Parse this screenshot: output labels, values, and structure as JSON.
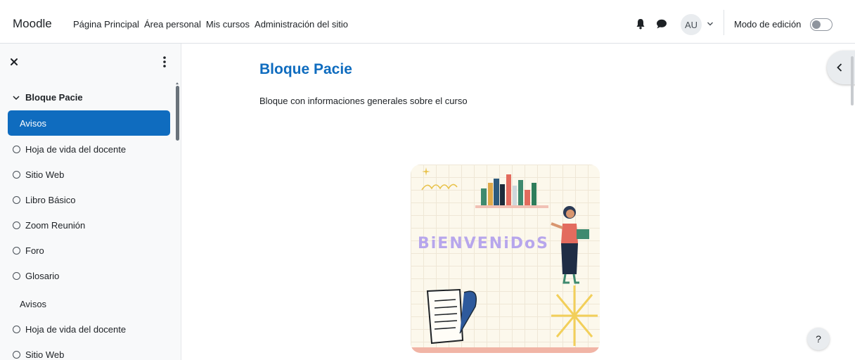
{
  "navbar": {
    "brand": "Moodle",
    "links": [
      "Página Principal",
      "Área personal",
      "Mis cursos",
      "Administración del sitio"
    ],
    "avatar_initials": "AU",
    "edit_mode_label": "Modo de edición",
    "edit_mode_on": false
  },
  "drawer": {
    "section_title": "Bloque Pacie",
    "items": [
      {
        "label": "Avisos",
        "active": true,
        "marker": false
      },
      {
        "label": "Hoja de vida del docente",
        "active": false,
        "marker": true
      },
      {
        "label": "Sitio Web",
        "active": false,
        "marker": true
      },
      {
        "label": "Libro Básico",
        "active": false,
        "marker": true
      },
      {
        "label": "Zoom Reunión",
        "active": false,
        "marker": true
      },
      {
        "label": "Foro",
        "active": false,
        "marker": true
      },
      {
        "label": "Glosario",
        "active": false,
        "marker": true
      },
      {
        "label": "Avisos",
        "active": false,
        "marker": false
      },
      {
        "label": "Hoja de vida del docente",
        "active": false,
        "marker": true
      },
      {
        "label": "Sitio Web",
        "active": false,
        "marker": true
      }
    ]
  },
  "main": {
    "title": "Bloque Pacie",
    "summary": "Bloque con informaciones generales sobre el curso",
    "banner_text": "BiENVENiDoS"
  },
  "help_label": "?",
  "colors": {
    "primary": "#0f6cbf",
    "drawer_bg": "#f8f9fa",
    "banner_bg": "#fcf8ec",
    "banner_text": "#b7a6ec"
  },
  "icons": [
    "bell-icon",
    "chat-icon",
    "chevron-down-icon",
    "close-icon",
    "kebab-icon",
    "chevron-left-icon"
  ]
}
